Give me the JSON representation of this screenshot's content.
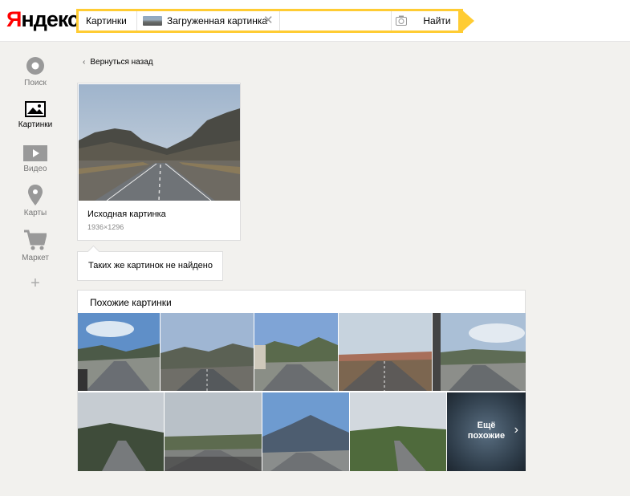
{
  "header": {
    "logo_first": "Я",
    "logo_rest": "ндекс",
    "search_chip_service": "Картинки",
    "search_chip_uploaded": "Загруженная картинка",
    "search_button": "Найти",
    "icons": [
      "close-icon",
      "camera-icon"
    ]
  },
  "nav": {
    "items": [
      {
        "label": "Поиск",
        "icon": "search-circle-icon",
        "active": false
      },
      {
        "label": "Картинки",
        "icon": "image-icon",
        "active": true
      },
      {
        "label": "Видео",
        "icon": "video-icon",
        "active": false
      },
      {
        "label": "Карты",
        "icon": "map-pin-icon",
        "active": false
      },
      {
        "label": "Маркет",
        "icon": "cart-icon",
        "active": false
      }
    ],
    "more_icon": "plus-icon"
  },
  "back_link": "Вернуться назад",
  "original": {
    "title": "Исходная картинка",
    "size": "1936×1296"
  },
  "notfound": "Таких же картинок не найдено",
  "similar": {
    "title": "Похожие картинки",
    "more_line1": "Ещё",
    "more_line2": "похожие"
  },
  "colors": {
    "brand_red": "#ff0000",
    "search_yellow": "#ffcc33"
  }
}
